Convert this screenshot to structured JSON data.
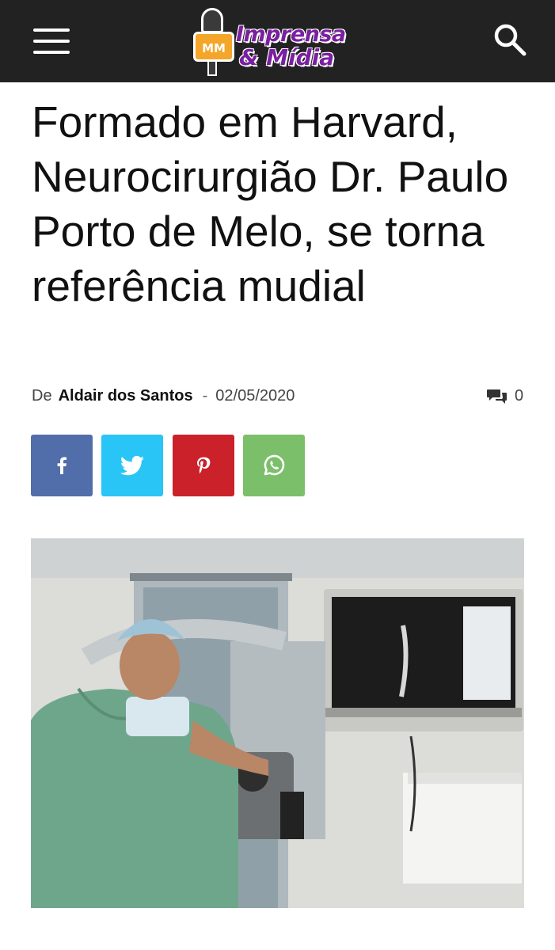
{
  "header": {
    "menu_icon": "hamburger-menu-icon",
    "logo": {
      "badge": "MM",
      "line1": "Imprensa",
      "line2": "& Mídia"
    },
    "search_icon": "search-icon",
    "background_color": "#222222"
  },
  "article": {
    "title": "Formado em Harvard, Neurocirurgião Dr. Paulo Porto de Melo, se torna referência mudial",
    "byline_prefix": "De",
    "author": "Aldair dos Santos",
    "separator": "-",
    "date": "02/05/2020",
    "comment_count": "0"
  },
  "share": {
    "buttons": [
      {
        "network": "facebook",
        "icon": "facebook-icon",
        "color": "#516eab"
      },
      {
        "network": "twitter",
        "icon": "twitter-icon",
        "color": "#29c5f6"
      },
      {
        "network": "pinterest",
        "icon": "pinterest-icon",
        "color": "#ca212a"
      },
      {
        "network": "whatsapp",
        "icon": "whatsapp-icon",
        "color": "#7bbf6a"
      }
    ]
  }
}
